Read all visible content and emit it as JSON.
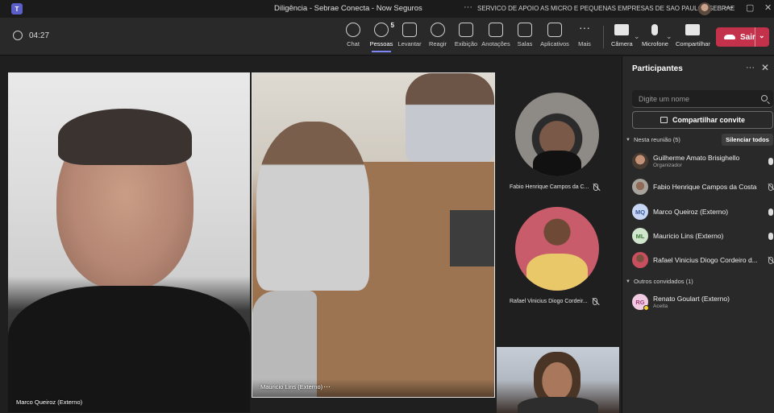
{
  "window": {
    "title": "Diligência - Sebrae Conecta - Now Seguros",
    "organization": "SERVICO DE APOIO AS MICRO E PEQUENAS EMPRESAS DE SAO PAULO - SEBRAE",
    "more": "···",
    "minimize": "—",
    "maximize": "▢",
    "close": "✕"
  },
  "meeting": {
    "elapsed": "04:27"
  },
  "toolbar": {
    "chat": "Chat",
    "people": "Pessoas",
    "people_count": "5",
    "raise": "Levantar",
    "react": "Reagir",
    "view": "Exibição",
    "notes": "Anotações",
    "rooms": "Salas",
    "apps": "Aplicativos",
    "more": "Mais",
    "camera": "Câmera",
    "mic": "Microfone",
    "share": "Compartilhar",
    "leave": "Sair"
  },
  "stage": {
    "tiles": [
      {
        "name": "Marco Queiroz (Externo)"
      },
      {
        "name": "Mauricio Lins (Externo)"
      },
      {
        "name": "Fabio Henrique Campos da C..."
      },
      {
        "name": "Rafael Vinicius Diogo Cordeir..."
      }
    ],
    "more": "···"
  },
  "panel": {
    "title": "Participantes",
    "more": "···",
    "close": "✕",
    "search_placeholder": "Digite um nome",
    "share_invite": "Compartilhar convite",
    "in_meeting_label": "Nesta reunião (5)",
    "mute_all": "Silenciar todos",
    "others_label": "Outros convidados (1)",
    "participants": [
      {
        "name": "Guilherme Amato Brisighello",
        "role": "Organizador",
        "initials": "",
        "mic": "on"
      },
      {
        "name": "Fabio Henrique Campos da Costa",
        "role": "",
        "initials": "",
        "mic": "off"
      },
      {
        "name": "Marco Queiroz (Externo)",
        "role": "",
        "initials": "MQ",
        "mic": "on"
      },
      {
        "name": "Mauricio Lins (Externo)",
        "role": "",
        "initials": "ML",
        "mic": "on"
      },
      {
        "name": "Rafael Vinicius Diogo Cordeiro d...",
        "role": "",
        "initials": "",
        "mic": "off"
      }
    ],
    "invited": [
      {
        "name": "Renato Goulart (Externo)",
        "role": "Aceita",
        "initials": "RG"
      }
    ]
  },
  "colors": {
    "accent": "#7f85f5",
    "leave": "#c4314b",
    "background": "#1f1f1f",
    "panel": "#292929"
  }
}
